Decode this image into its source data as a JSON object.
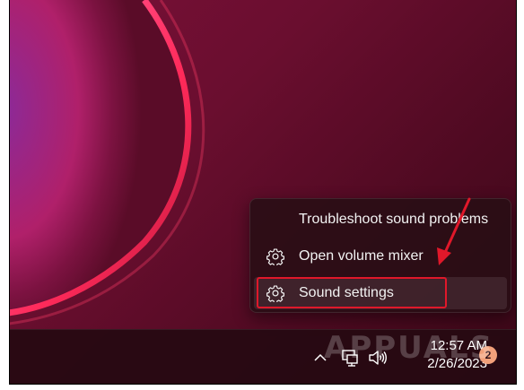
{
  "context_menu": {
    "items": [
      {
        "label": "Troubleshoot sound problems",
        "icon": "none"
      },
      {
        "label": "Open volume mixer",
        "icon": "gear-icon"
      },
      {
        "label": "Sound settings",
        "icon": "gear-icon"
      }
    ]
  },
  "taskbar": {
    "clock": {
      "time": "12:57 AM",
      "date": "2/26/2023"
    },
    "notification_count": "2",
    "tray_icons": [
      "chevron-up-icon",
      "network-icon",
      "volume-icon"
    ]
  },
  "watermark": "APPUALS",
  "annotations": {
    "highlight_color": "#e0182a",
    "arrow_color": "#e0182a"
  }
}
